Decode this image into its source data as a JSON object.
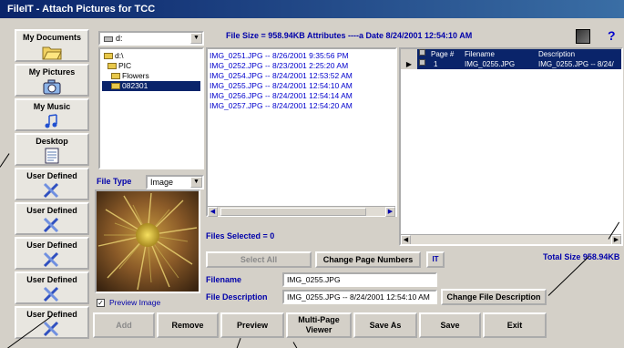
{
  "window": {
    "title": "FileIT - Attach Pictures for TCC"
  },
  "sidebar": {
    "items": [
      {
        "label": "My Documents",
        "icon": "folder-icon"
      },
      {
        "label": "My Pictures",
        "icon": "camera-icon"
      },
      {
        "label": "My Music",
        "icon": "music-note-icon"
      },
      {
        "label": "Desktop",
        "icon": "desktop-icon"
      },
      {
        "label": "User Defined",
        "icon": "tools-icon"
      },
      {
        "label": "User Defined",
        "icon": "tools-icon"
      },
      {
        "label": "User Defined",
        "icon": "tools-icon"
      },
      {
        "label": "User Defined",
        "icon": "tools-icon"
      },
      {
        "label": "User Defined",
        "icon": "tools-icon"
      }
    ]
  },
  "browser": {
    "drive": "d:",
    "tree": [
      "d:\\",
      "PIC",
      "Flowers",
      "082301"
    ],
    "file_type_label": "File Type",
    "file_type_value": "Image",
    "preview_label": "Preview Image",
    "preview_checked": true
  },
  "file_info": {
    "text": "File Size = 958.94KB  Attributes ----a  Date  8/24/2001 12:54:10 AM"
  },
  "file_list": {
    "items": [
      "IMG_0251.JPG -- 8/26/2001 9:35:56 PM",
      "IMG_0252.JPG -- 8/23/2001 2:25:20 AM",
      "IMG_0254.JPG -- 8/24/2001 12:53:52 AM",
      "IMG_0255.JPG -- 8/24/2001 12:54:10 AM",
      "IMG_0256.JPG -- 8/24/2001 12:54:14 AM",
      "IMG_0257.JPG -- 8/24/2001 12:54:20 AM"
    ],
    "files_selected": "Files Selected =  0"
  },
  "page_grid": {
    "headers": [
      "Page #",
      "Filename",
      "Description"
    ],
    "rows": [
      {
        "page": "1",
        "filename": "IMG_0255.JPG",
        "description": "IMG_0255.JPG -- 8/24/"
      }
    ]
  },
  "total_size": "Total Size 958.94KB",
  "buttons": {
    "select_all": "Select All",
    "change_page_numbers": "Change Page Numbers",
    "change_file_description": "Change File Description",
    "add": "Add",
    "remove": "Remove",
    "preview": "Preview",
    "multi_page_viewer": "Multi-Page Viewer",
    "save_as": "Save As",
    "save": "Save",
    "exit": "Exit"
  },
  "fields": {
    "filename_label": "Filename",
    "filename_value": "IMG_0255.JPG",
    "description_label": "File Description",
    "description_value": "IMG_0255.JPG -- 8/24/2001 12:54:10 AM"
  },
  "colors": {
    "label_blue": "#0000aa",
    "title_blue": "#0a246a",
    "face": "#d4d0c8"
  }
}
